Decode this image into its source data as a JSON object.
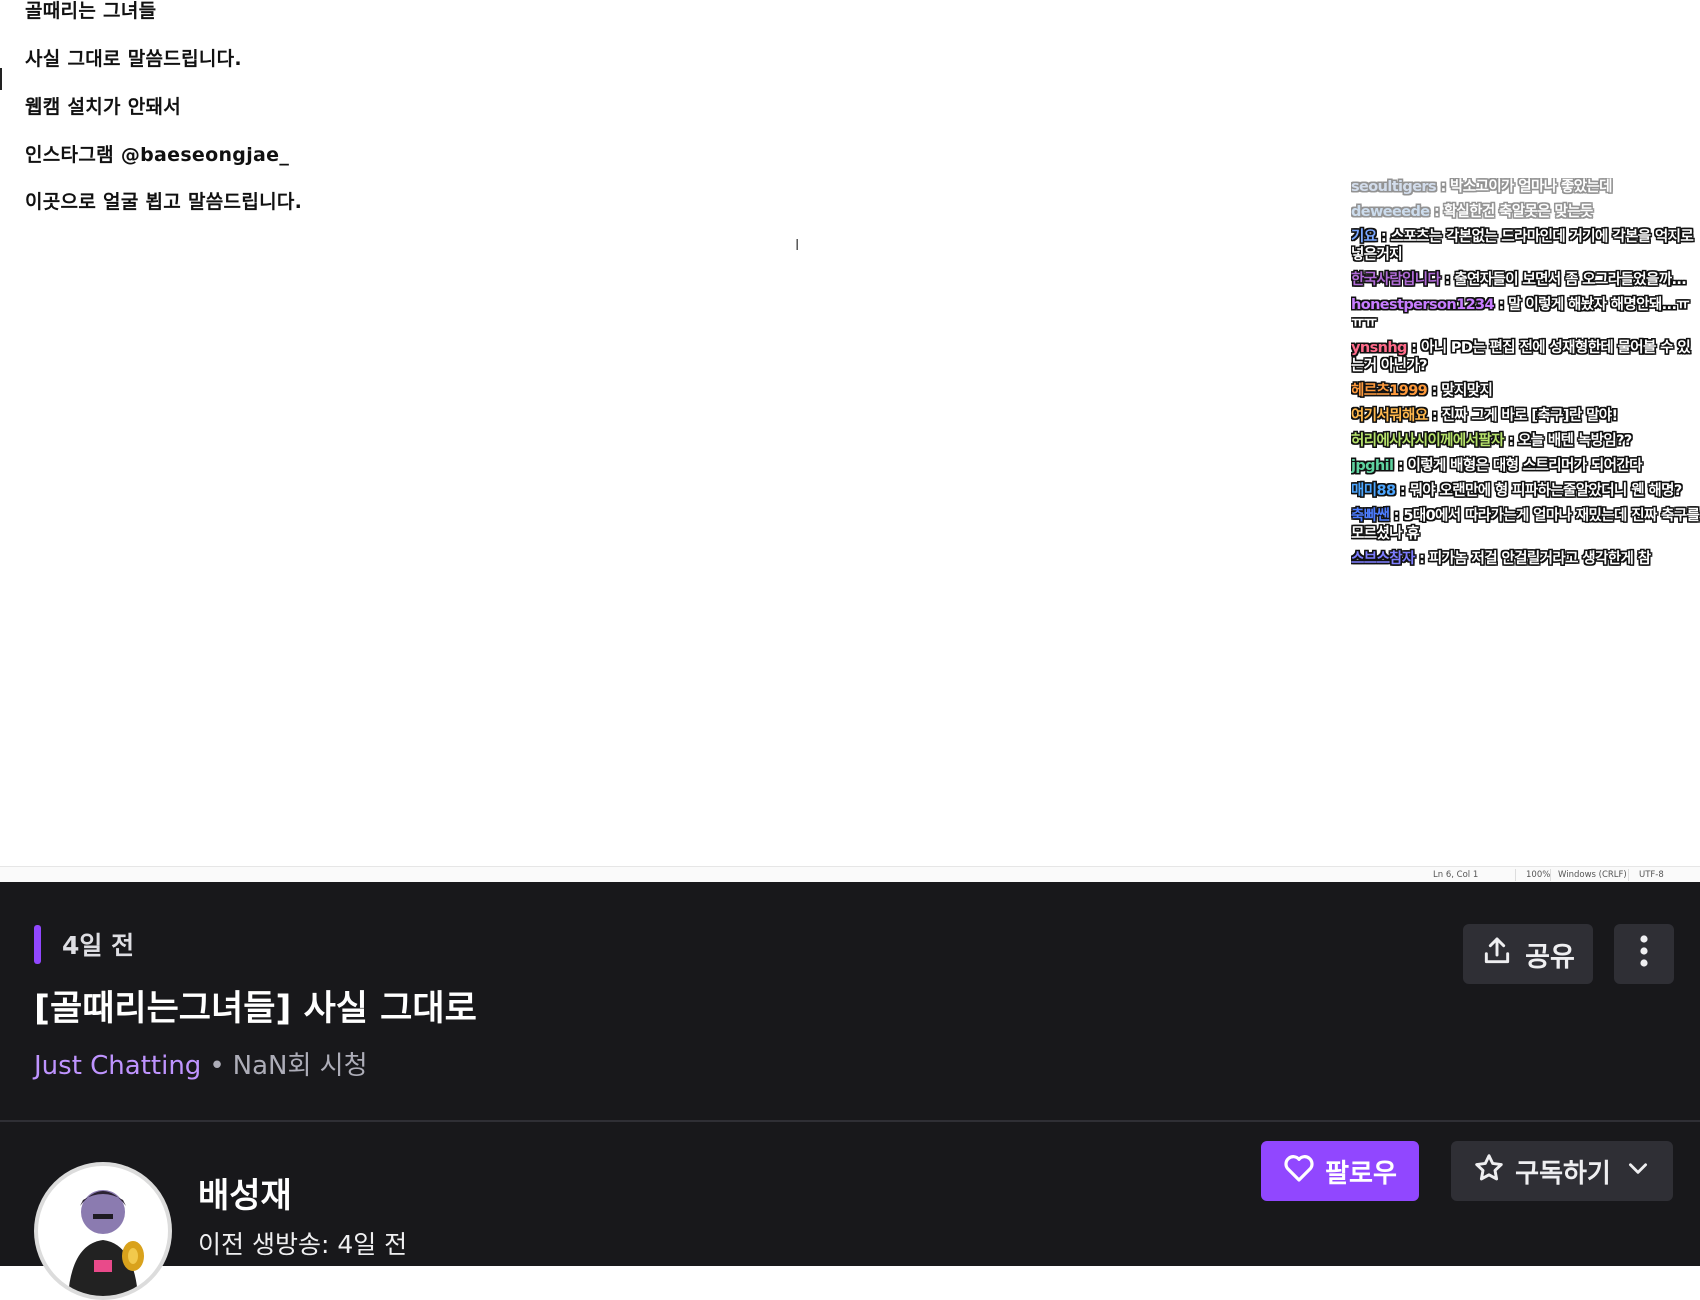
{
  "notepad": {
    "lines": [
      "골때리는 그녀들",
      "사실 그대로 말씀드립니다.",
      "웹캠 설치가 안돼서",
      "인스타그램 @baeseongjae_",
      "이곳으로 얼굴 뵙고 말씀드립니다."
    ],
    "status": {
      "position": "Ln 6, Col 1",
      "zoom": "100%",
      "line_ending": "Windows (CRLF)",
      "encoding": "UTF-8"
    }
  },
  "overlay_chat": {
    "messages": [
      {
        "user": "seoultigers",
        "text": "박소고이가 얼마나 좋았는데",
        "color": "#9fb6d6"
      },
      {
        "user": "deweeede",
        "text": "확실한건 축알못은 맞는듯",
        "color": "#8fb3d9"
      },
      {
        "user": "기요",
        "text": "스포츠는 각본없는 드라마인데 거기에 각본을 억지로 넣은거지",
        "color": "#7aa7ff"
      },
      {
        "user": "한국사람입니다",
        "text": "출연자들이 보면서 좀 오그라들었을까...",
        "color": "#b06bd6"
      },
      {
        "user": "honestperson1234",
        "text": "말 이렇게 해놨자 해명안돼...ㅠㅠㅠ",
        "color": "#c77dff"
      },
      {
        "user": "ynsnhg",
        "text": "아니 PD는 편집 전에 성재형한테 물어볼 수 있는거 아닌가?",
        "color": "#ff6b8a"
      },
      {
        "user": "헤르츠1999",
        "text": "맞지맞지",
        "color": "#ff9a3c"
      },
      {
        "user": "여기서뭐해요",
        "text": "진짜 그게 바로 [축구]란 말야!",
        "color": "#ffb84d"
      },
      {
        "user": "허리에사사시이께에서팔자",
        "text": "오늘 배텐 녹방임??",
        "color": "#b7e36b"
      },
      {
        "user": "jpghil",
        "text": "이렇게 배형은 대형 스트리머가 되어간다",
        "color": "#5fd3a0"
      },
      {
        "user": "매미88",
        "text": "뭐야 오랜만에 형 피파하는줄알았더니 웬 해명?",
        "color": "#4da6ff"
      },
      {
        "user": "축빠쌘",
        "text": "5대0에서 따라가는게 얼마나 재밌는데 진짜 축구를 모르셨나 휴",
        "color": "#4d7dff"
      },
      {
        "user": "스브스참자",
        "text": "피가놈 저걸 안걸릴거라고 생각한게 참",
        "color": "#7d7dff"
      }
    ]
  },
  "video_info": {
    "date": "4일 전",
    "title": "[골때리는그녀들] 사실 그대로",
    "category": "Just Chatting",
    "separator": "•",
    "views": "NaN회 시청",
    "share_label": "공유"
  },
  "channel": {
    "name": "배성재",
    "last_live": "이전 생방송: 4일 전",
    "follow_label": "팔로우",
    "subscribe_label": "구독하기"
  },
  "colors": {
    "accent": "#9147ff",
    "panel_bg": "#18181b",
    "category": "#bf94ff"
  }
}
